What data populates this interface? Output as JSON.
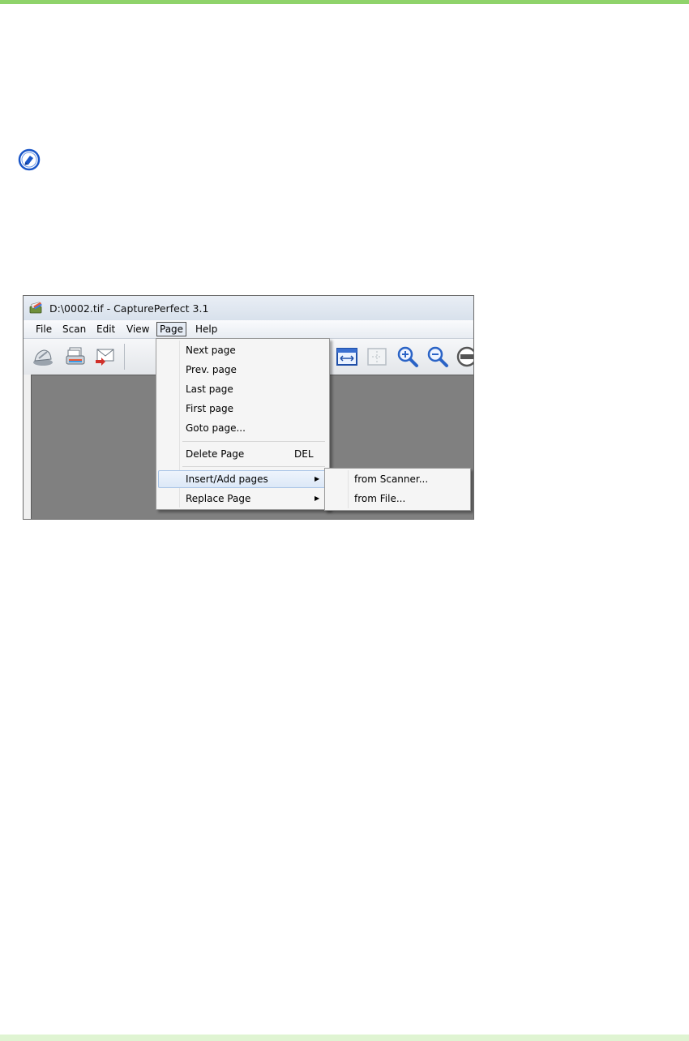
{
  "colors": {
    "top_rule": "#8fd36b",
    "bottom_rule": "#dff4d2",
    "note_icon": "#1a56c8",
    "highlight": "#dce8f7"
  },
  "note": {
    "icon": "note-pencil-icon"
  },
  "window": {
    "title": "D:\\0002.tif - CapturePerfect 3.1",
    "app_icon": "captureperfect-app-icon",
    "menu": [
      "File",
      "Scan",
      "Edit",
      "View",
      "Page",
      "Help"
    ],
    "active_menu": "Page",
    "toolbar_icons": [
      "scan-icon",
      "scan-batch-icon",
      "email-icon",
      "fit-width-icon",
      "fit-page-icon",
      "zoom-in-icon",
      "zoom-out-icon",
      "zoom-100-icon"
    ]
  },
  "page_menu": {
    "items": [
      {
        "label": "Next page"
      },
      {
        "label": "Prev. page"
      },
      {
        "label": "Last page"
      },
      {
        "label": "First page"
      },
      {
        "label": "Goto page..."
      },
      {
        "label": "Delete Page",
        "shortcut": "DEL"
      },
      {
        "label": "Insert/Add pages",
        "submenu": true,
        "highlighted": true
      },
      {
        "label": "Replace Page",
        "submenu": true
      }
    ]
  },
  "insert_submenu": {
    "items": [
      {
        "label": "from Scanner..."
      },
      {
        "label": "from File..."
      }
    ]
  }
}
